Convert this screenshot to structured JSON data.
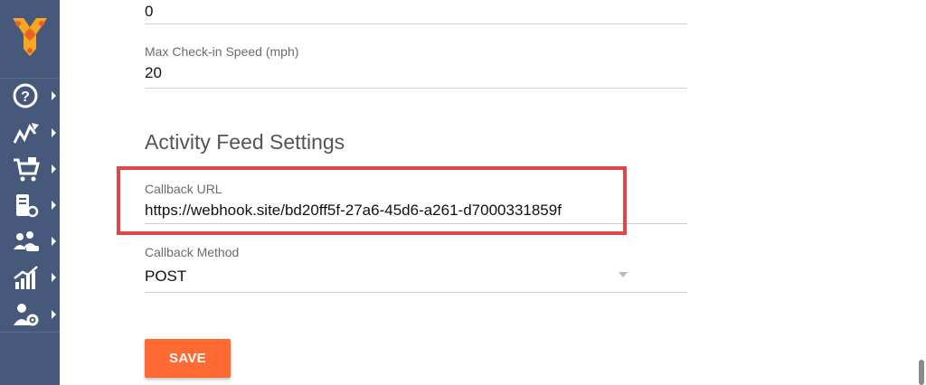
{
  "sidebar": {
    "logo": "brand-logo",
    "items": [
      {
        "icon": "help-icon"
      },
      {
        "icon": "route-icon"
      },
      {
        "icon": "cart-icon"
      },
      {
        "icon": "device-settings-icon"
      },
      {
        "icon": "team-icon"
      },
      {
        "icon": "analytics-icon"
      },
      {
        "icon": "user-settings-icon"
      }
    ]
  },
  "form": {
    "top_value": "0",
    "max_checkin": {
      "label": "Max Check-in Speed (mph)",
      "value": "20"
    },
    "section_title": "Activity Feed Settings",
    "callback_url": {
      "label": "Callback URL",
      "value": "https://webhook.site/bd20ff5f-27a6-45d6-a261-d7000331859f"
    },
    "callback_method": {
      "label": "Callback Method",
      "value": "POST"
    },
    "save_label": "SAVE"
  },
  "colors": {
    "sidebar": "#47597b",
    "accent": "#ff6a33",
    "highlight": "#e04848"
  }
}
